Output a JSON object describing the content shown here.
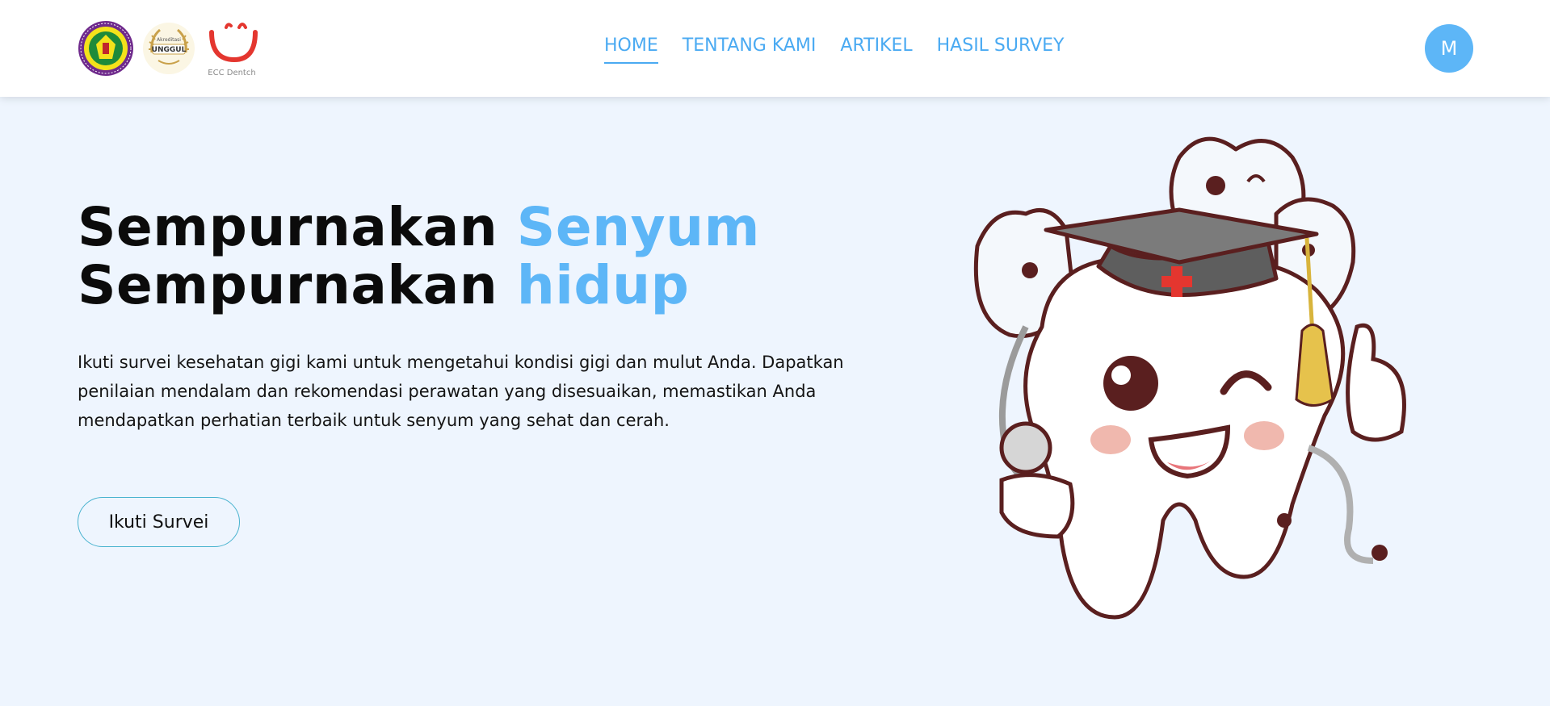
{
  "header": {
    "logos": {
      "ecc_caption": "ECC Dentch",
      "award_text": "UNGGUL",
      "award_caption": "Akreditasi"
    },
    "nav": [
      {
        "label": "HOME",
        "active": true
      },
      {
        "label": "TENTANG KAMI",
        "active": false
      },
      {
        "label": "ARTIKEL",
        "active": false
      },
      {
        "label": "HASIL SURVEY",
        "active": false
      }
    ],
    "avatar_initial": "M"
  },
  "hero": {
    "line1_prefix": "Sempurnakan",
    "line1_accent": "Senyum",
    "line2_prefix": "Sempurnakan",
    "line2_accent": "hidup",
    "description": "Ikuti survei kesehatan gigi kami untuk mengetahui kondisi gigi dan mulut Anda. Dapatkan penilaian mendalam dan rekomendasi perawatan yang disesuaikan, memastikan Anda mendapatkan perhatian terbaik untuk senyum yang sehat dan cerah.",
    "cta_label": "Ikuti Survei"
  },
  "colors": {
    "accent": "#5db6f7",
    "background": "#eef5fe",
    "header_bg": "#ffffff",
    "tooth_outline": "#5a1f1f"
  },
  "icons": {
    "logo_1": "regency-seal-logo",
    "logo_2": "unggul-accreditation-badge",
    "logo_3": "ecc-dentch-smile-logo",
    "illustration": "graduate-tooth-mascot"
  }
}
